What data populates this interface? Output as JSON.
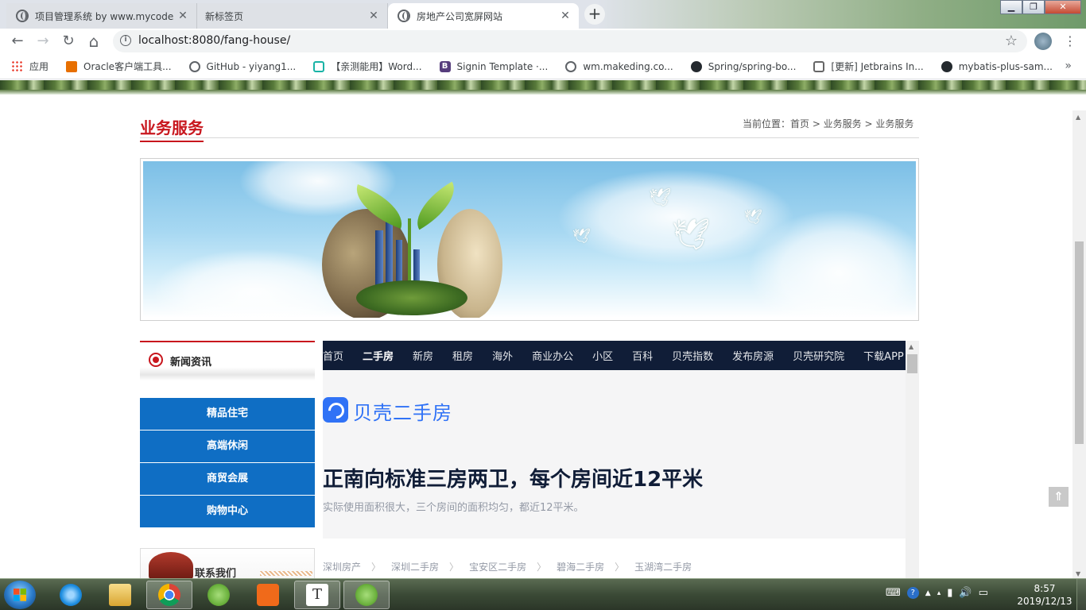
{
  "browser": {
    "tabs": [
      {
        "title": "项目管理系统 by www.mycodes.net",
        "active": false
      },
      {
        "title": "新标签页",
        "active": false
      },
      {
        "title": "房地产公司宽屏网站",
        "active": true
      }
    ],
    "close_glyph": "✕",
    "new_tab_glyph": "+",
    "url": "localhost:8080/fang-house/",
    "info_glyph": "i",
    "star_glyph": "☆",
    "window_controls": {
      "minimize": "▁",
      "maximize": "❐",
      "close": "✕"
    },
    "nav": {
      "back": "←",
      "forward": "→",
      "reload": "↻",
      "home": "⌂"
    },
    "menu_glyph": "⋮",
    "bookmarks": [
      {
        "label": "应用",
        "icon": "apps-icon"
      },
      {
        "label": "Oracle客户端工具...",
        "icon": "java-icon"
      },
      {
        "label": "GitHub - yiyang1...",
        "icon": "globe-icon"
      },
      {
        "label": "【亲测能用】Word...",
        "icon": "play-icon"
      },
      {
        "label": "Signin Template ·...",
        "icon": "bootstrap-icon"
      },
      {
        "label": "wm.makeding.co...",
        "icon": "globe-icon"
      },
      {
        "label": "Spring/spring-bo...",
        "icon": "github-icon"
      },
      {
        "label": "[更新] Jetbrains In...",
        "icon": "jetbrains-icon"
      },
      {
        "label": "mybatis-plus-sam...",
        "icon": "github-icon"
      }
    ],
    "bookmarks_more": "»"
  },
  "page": {
    "section_title": "业务服务",
    "breadcrumb": "当前位置：首页 > 业务服务 > 业务服务",
    "sidebar": {
      "news_title": "新闻资讯",
      "items": [
        "精品住宅",
        "高端休闲",
        "商贸会展",
        "购物中心"
      ],
      "contact_title": "联系我们"
    },
    "to_top_glyph": "⇑",
    "scroll_up_glyph": "▲",
    "scroll_down_glyph": "▼"
  },
  "embedded": {
    "nav": [
      "首页",
      "二手房",
      "新房",
      "租房",
      "海外",
      "商业办公",
      "小区",
      "百科",
      "贝壳指数",
      "发布房源",
      "贝壳研究院",
      "下载APP"
    ],
    "nav_active": "二手房",
    "brand": "贝壳二手房",
    "headline": "正南向标准三房两卫，每个房间近12平米",
    "subline": "实际使用面积很大，三个房间的面积均匀，都近12平米。",
    "crumbs": [
      "深圳房产",
      "深圳二手房",
      "宝安区二手房",
      "碧海二手房",
      "玉湖湾二手房"
    ],
    "crumb_sep": "〉",
    "scroll_up_glyph": "▲"
  },
  "taskbar": {
    "apps": [
      {
        "name": "ie",
        "color": "#1f8fe0"
      },
      {
        "name": "explorer",
        "color": "#e8b84a"
      },
      {
        "name": "chrome",
        "color": "#db4437"
      },
      {
        "name": "spring-tool",
        "color": "#6db33f"
      },
      {
        "name": "app-orange",
        "color": "#f06a1a"
      },
      {
        "name": "typora",
        "color": "#ffffff"
      },
      {
        "name": "spring-tool-2",
        "color": "#6db33f"
      }
    ],
    "time": "8:57",
    "date": "2019/12/13"
  },
  "colors": {
    "accent_red": "#c8161d",
    "sidebar_blue": "#0f6ec4",
    "beike_blue": "#3072f6",
    "beike_nav": "#101d37"
  }
}
